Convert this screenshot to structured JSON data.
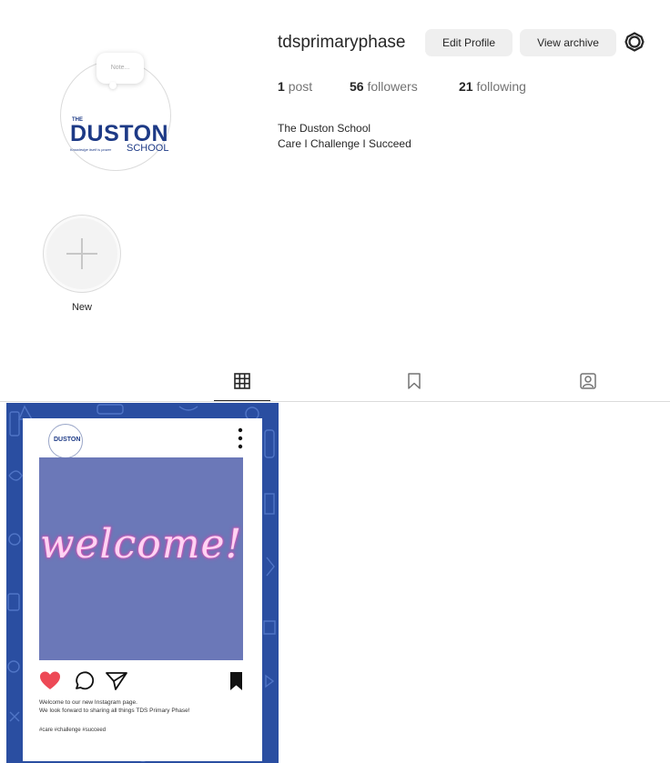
{
  "profile": {
    "username": "tdsprimaryphase",
    "note_placeholder": "Note...",
    "logo": {
      "the": "THE",
      "duston": "DUSTON",
      "school": "SCHOOL",
      "tagline": "Knowledge itself is power"
    },
    "buttons": {
      "edit": "Edit Profile",
      "archive": "View archive"
    },
    "stats": {
      "posts_count": "1",
      "posts_label": "post",
      "followers_count": "56",
      "followers_label": "followers",
      "following_count": "21",
      "following_label": "following"
    },
    "bio_name": "The Duston School",
    "bio_text": "Care I Challenge I Succeed"
  },
  "highlights": [
    {
      "label": "New"
    }
  ],
  "tabs": [
    {
      "name": "posts",
      "icon": "grid-icon",
      "active": true
    },
    {
      "name": "saved",
      "icon": "bookmark-icon",
      "active": false
    },
    {
      "name": "tagged",
      "icon": "tagged-icon",
      "active": false
    }
  ],
  "post": {
    "avatar_text": "DUSTON",
    "image_text": "welcome!",
    "caption_line1": "Welcome to our new Instagram page.",
    "caption_line2": "We look forward to sharing all things TDS Primary Phase!",
    "hashtags": "#care #challenge #succeed"
  },
  "colors": {
    "tile_bg": "#2a4ea1",
    "image_bg": "#6b78b8",
    "like_red": "#ed4956",
    "text": "#262626",
    "muted": "#737373",
    "button_bg": "#efefef"
  }
}
